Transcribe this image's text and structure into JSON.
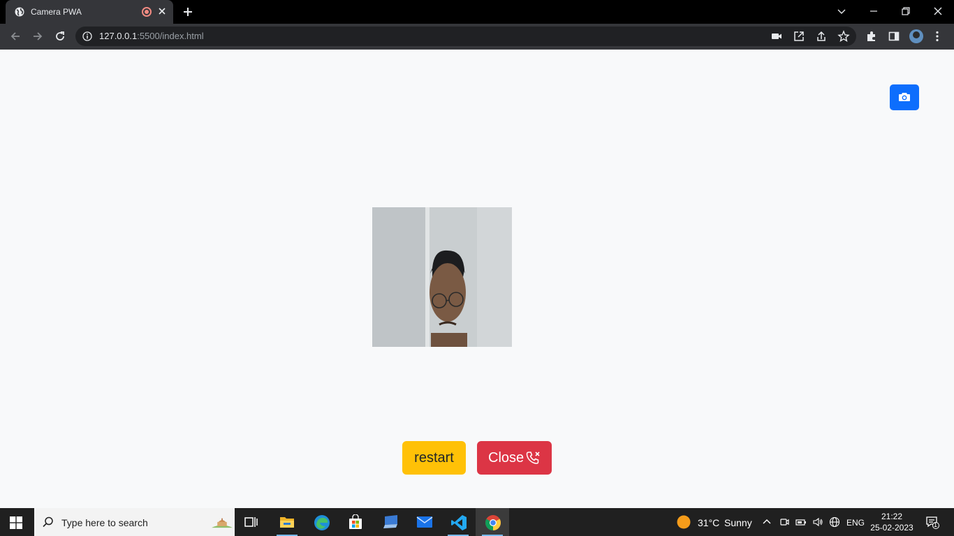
{
  "browser": {
    "tab_title": "Camera PWA",
    "url_host": "127.0.0.1",
    "url_rest": ":5500/index.html"
  },
  "page": {
    "restart_label": "restart",
    "close_label": "Close",
    "accent_blue": "#0d6efd",
    "warning_yellow": "#ffc107",
    "danger_red": "#dc3545"
  },
  "taskbar": {
    "search_placeholder": "Type here to search",
    "weather_temp": "31°C",
    "weather_desc": "Sunny",
    "language": "ENG",
    "time": "21:22",
    "date": "25-02-2023",
    "notification_count": "1",
    "apps": [
      "task-view",
      "file-explorer",
      "edge",
      "microsoft-store",
      "remote-desktop",
      "mail",
      "vs-code",
      "chrome"
    ]
  }
}
